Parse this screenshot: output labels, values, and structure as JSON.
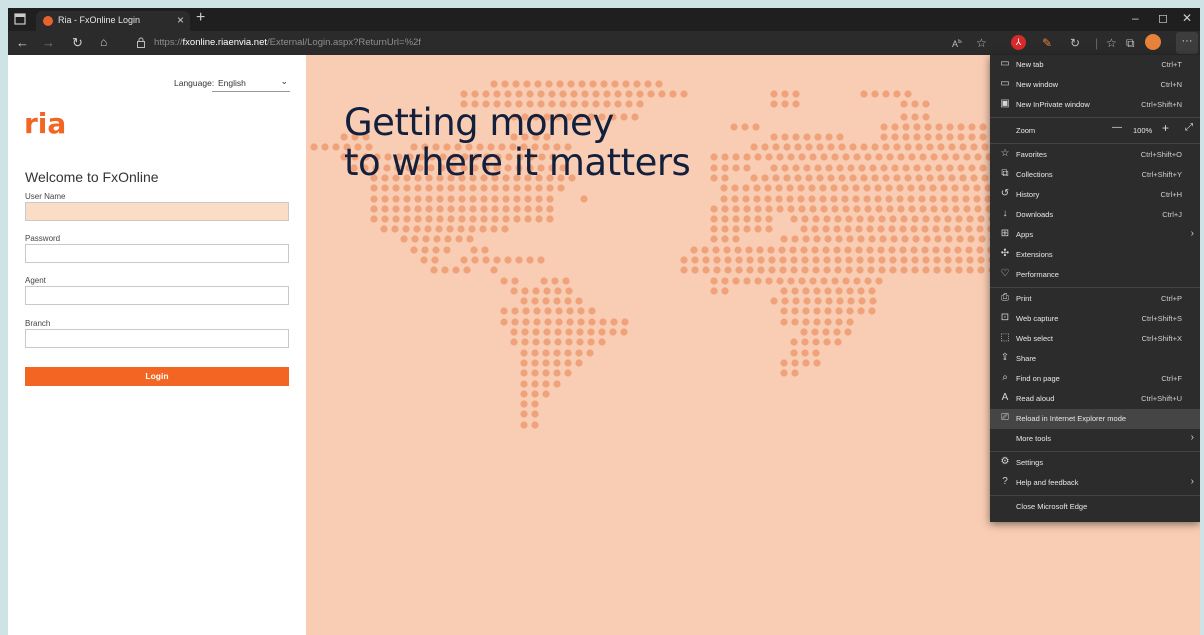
{
  "browser": {
    "tab_title": "Ria - FxOnline Login",
    "url_prefix": "https://",
    "url_domain": "fxonline.riaenvia.net",
    "url_path": "/External/Login.aspx?ReturnUrl=%2f"
  },
  "login": {
    "language_label": "Language:",
    "language_value": "English",
    "welcome": "Welcome to FxOnline",
    "username_label": "User Name",
    "password_label": "Password",
    "agent_label": "Agent",
    "branch_label": "Branch",
    "login_button": "Login",
    "logo_text": "ria"
  },
  "hero": {
    "line1": "Getting money",
    "line2": "to where it matters"
  },
  "menu": {
    "items": [
      {
        "icon": "new-tab-icon",
        "label": "New tab",
        "shortcut": "Ctrl+T"
      },
      {
        "icon": "new-window-icon",
        "label": "New window",
        "shortcut": "Ctrl+N"
      },
      {
        "icon": "inprivate-icon",
        "label": "New InPrivate window",
        "shortcut": "Ctrl+Shift+N"
      },
      {
        "label": "Zoom",
        "zoom": "100%"
      },
      {
        "icon": "favorites-icon",
        "label": "Favorites",
        "shortcut": "Ctrl+Shift+O"
      },
      {
        "icon": "collections-icon",
        "label": "Collections",
        "shortcut": "Ctrl+Shift+Y"
      },
      {
        "icon": "history-icon",
        "label": "History",
        "shortcut": "Ctrl+H"
      },
      {
        "icon": "downloads-icon",
        "label": "Downloads",
        "shortcut": "Ctrl+J"
      },
      {
        "icon": "apps-icon",
        "label": "Apps",
        "shortcut": ""
      },
      {
        "icon": "extensions-icon",
        "label": "Extensions",
        "shortcut": ""
      },
      {
        "icon": "performance-icon",
        "label": "Performance",
        "shortcut": ""
      },
      {
        "icon": "print-icon",
        "label": "Print",
        "shortcut": "Ctrl+P"
      },
      {
        "icon": "web-capture-icon",
        "label": "Web capture",
        "shortcut": "Ctrl+Shift+S"
      },
      {
        "icon": "web-select-icon",
        "label": "Web select",
        "shortcut": "Ctrl+Shift+X"
      },
      {
        "icon": "share-icon",
        "label": "Share",
        "shortcut": ""
      },
      {
        "icon": "find-icon",
        "label": "Find on page",
        "shortcut": "Ctrl+F"
      },
      {
        "icon": "read-aloud-icon",
        "label": "Read aloud",
        "shortcut": "Ctrl+Shift+U"
      },
      {
        "icon": "ie-mode-icon",
        "label": "Reload in Internet Explorer mode",
        "shortcut": ""
      },
      {
        "label": "More tools",
        "shortcut": ""
      },
      {
        "icon": "settings-icon",
        "label": "Settings",
        "shortcut": ""
      },
      {
        "icon": "help-icon",
        "label": "Help and feedback",
        "shortcut": ""
      },
      {
        "label": "Close Microsoft Edge",
        "shortcut": ""
      }
    ]
  },
  "colors": {
    "accent": "#f26522",
    "hero_bg": "#f8cdb3",
    "dots": "#f0a27a",
    "headline": "#13203d"
  }
}
